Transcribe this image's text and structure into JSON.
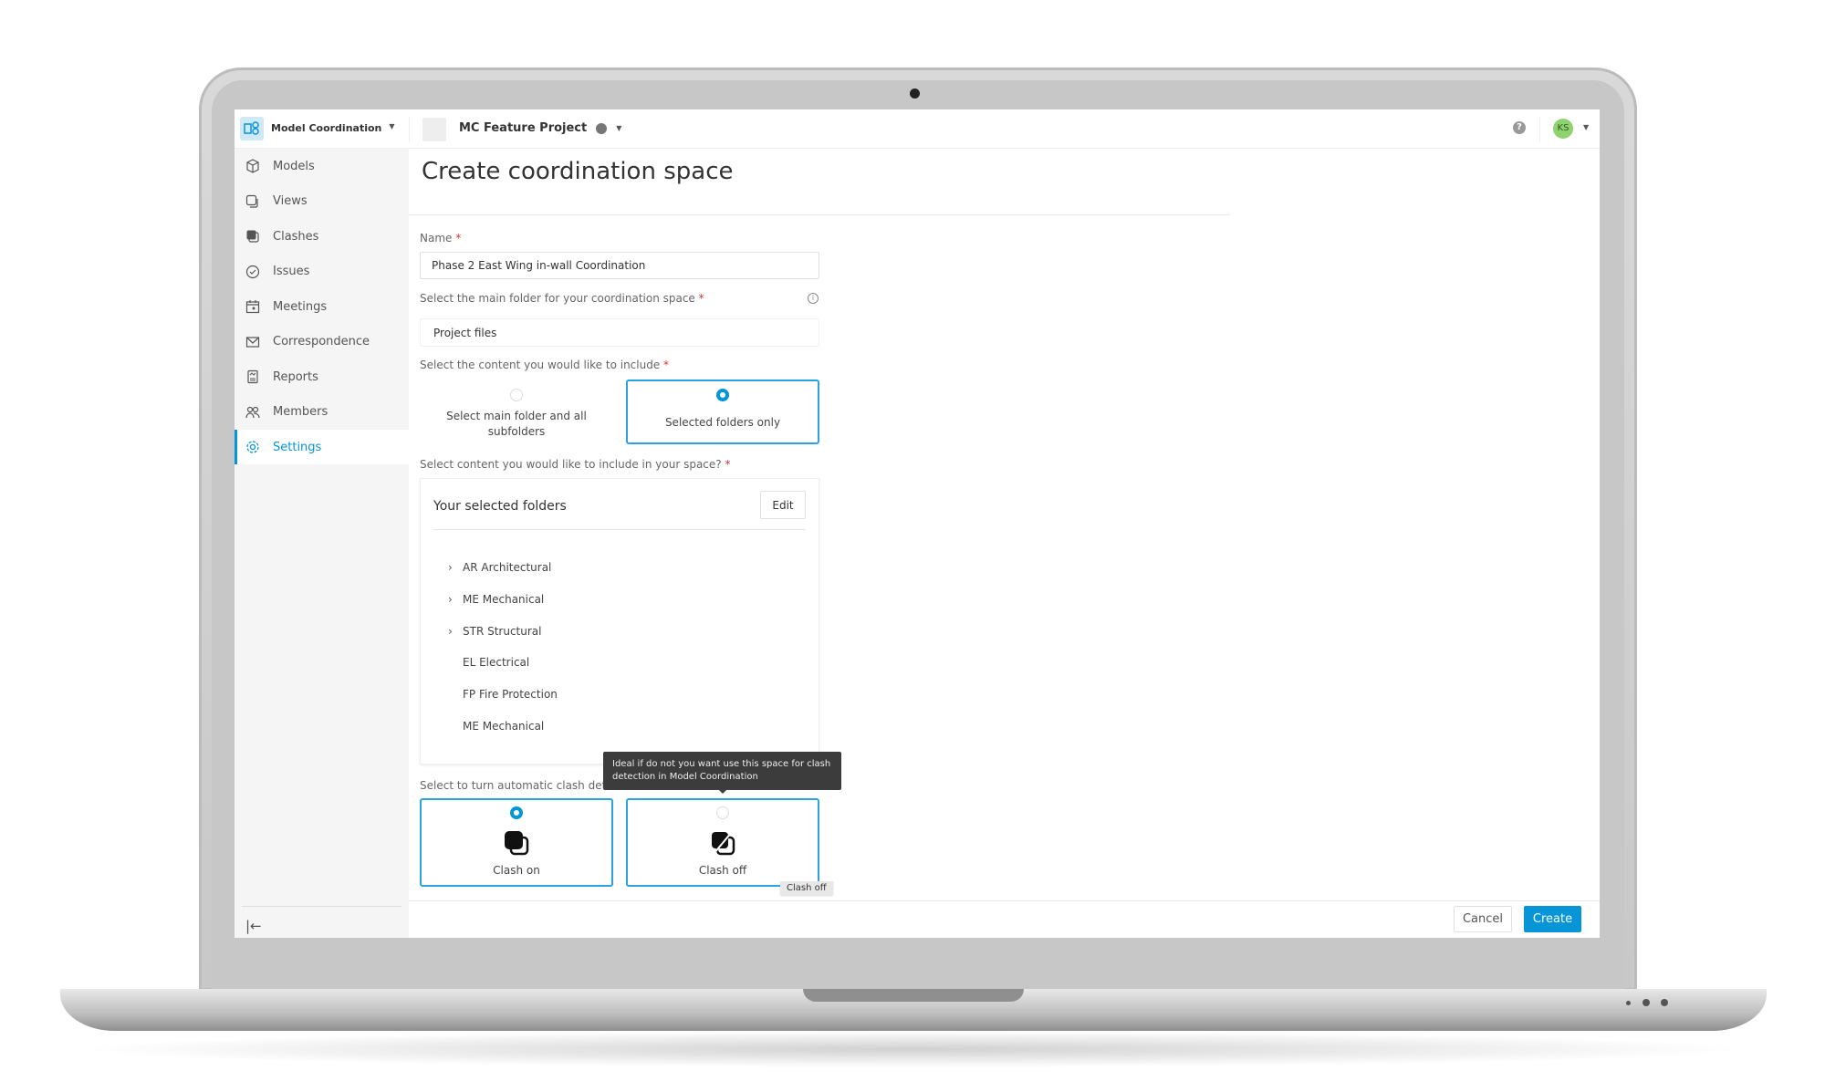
{
  "app": {
    "product": "Model Coordination",
    "project": "Project icon",
    "project_name": "MC Feature Project",
    "avatar_initials": "KS",
    "accent": "#0696d7",
    "avatar_color": "#8ed36f"
  },
  "sidebar": {
    "items": [
      {
        "label": "Models",
        "icon": "cube-icon"
      },
      {
        "label": "Views",
        "icon": "views-icon"
      },
      {
        "label": "Clashes",
        "icon": "clashes-icon"
      },
      {
        "label": "Issues",
        "icon": "check-circle-icon"
      },
      {
        "label": "Meetings",
        "icon": "calendar-people-icon"
      },
      {
        "label": "Correspondence",
        "icon": "envelope-icon"
      },
      {
        "label": "Reports",
        "icon": "report-icon"
      },
      {
        "label": "Members",
        "icon": "people-icon"
      },
      {
        "label": "Settings",
        "icon": "gear-icon",
        "active": true
      }
    ]
  },
  "page": {
    "title": "Create coordination space",
    "name_label": "Name",
    "name_value": "Phase 2 East Wing in-wall Coordination",
    "folder_label": "Select the main folder for your coordination space",
    "folder_value": "Project files",
    "content_label": "Select the content you would like to include",
    "content_options": [
      {
        "label": "Select main folder and all subfolders",
        "selected": false
      },
      {
        "label": "Selected folders only",
        "selected": true
      }
    ],
    "space_label": "Select content you would like to include in your space?",
    "selected_title": "Your selected folders",
    "edit_label": "Edit",
    "folders": [
      {
        "name": "AR Architectural",
        "expandable": true
      },
      {
        "name": "ME Mechanical",
        "expandable": true
      },
      {
        "name": "STR Structural",
        "expandable": true
      },
      {
        "name": "EL Electrical",
        "expandable": false
      },
      {
        "name": "FP Fire Protection",
        "expandable": false
      },
      {
        "name": "ME Mechanical",
        "expandable": false
      }
    ],
    "clash_label": "Select to turn automatic clash detection",
    "clash_options": [
      {
        "label": "Clash on",
        "selected": true
      },
      {
        "label": "Clash off",
        "selected": false
      }
    ],
    "tooltip": "Ideal if do not you want use this space for clash detection in Model Coordination",
    "hover_tooltip": "Clash off",
    "required_mark": "*"
  },
  "footer": {
    "cancel": "Cancel",
    "create": "Create"
  }
}
